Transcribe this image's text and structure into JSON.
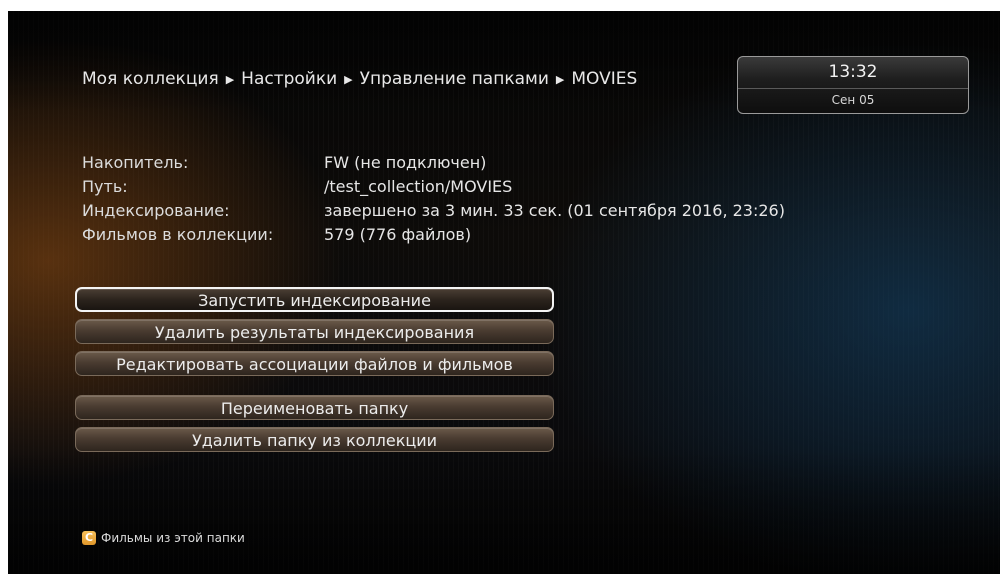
{
  "breadcrumb": {
    "items": [
      "Моя коллекция",
      "Настройки",
      "Управление папками",
      "MOVIES"
    ],
    "separator": "▶"
  },
  "clock": {
    "time": "13:32",
    "date": "Сен 05"
  },
  "info": {
    "rows": [
      {
        "label": "Накопитель:",
        "value": "FW (не подключен)"
      },
      {
        "label": "Путь:",
        "value": "/test_collection/MOVIES"
      },
      {
        "label": "Индексирование:",
        "value": "завершено за 3 мин. 33 сек. (01 сентября 2016, 23:26)"
      },
      {
        "label": "Фильмов в коллекции:",
        "value": "579 (776 файлов)"
      }
    ]
  },
  "menu": {
    "buttons": [
      {
        "label": "Запустить индексирование",
        "focused": true
      },
      {
        "label": "Удалить результаты индексирования",
        "focused": false
      },
      {
        "label": "Редактировать ассоциации файлов и фильмов",
        "focused": false
      },
      {
        "label": "Переименовать папку",
        "focused": false
      },
      {
        "label": "Удалить папку из коллекции",
        "focused": false
      }
    ]
  },
  "footer": {
    "key_letter": "C",
    "key_color": "#f0a93a",
    "hint": "Фильмы из этой папки"
  },
  "colors": {
    "focus_border": "#f4f4f4",
    "button_brown": "#4a3c31"
  }
}
